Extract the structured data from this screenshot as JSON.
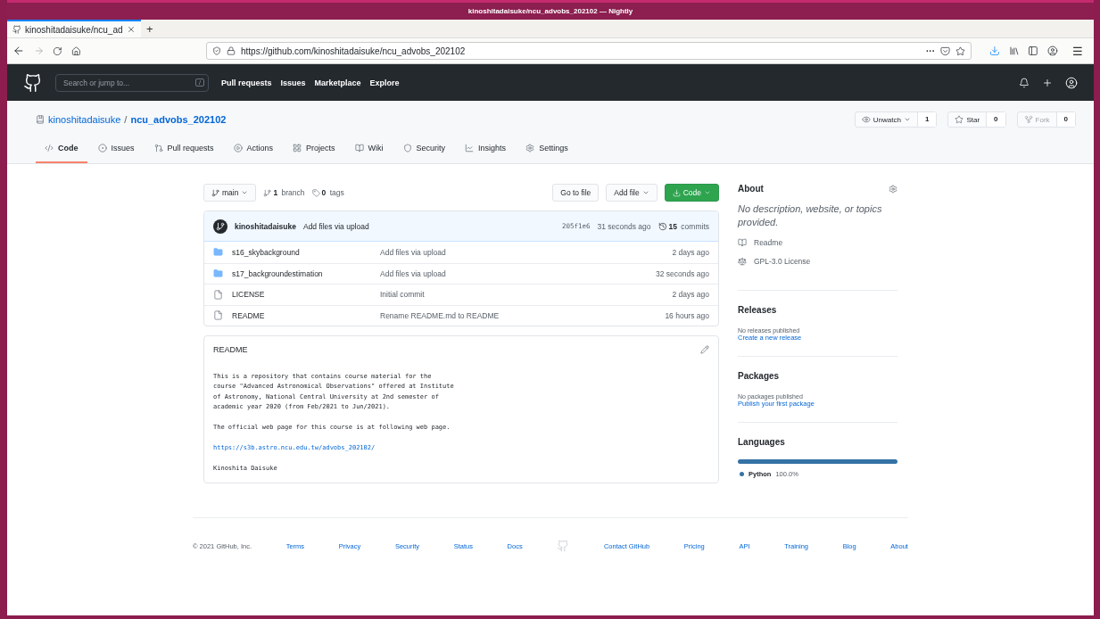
{
  "window": {
    "title": "kinoshitadaisuke/ncu_advobs_202102 — Nightly"
  },
  "browser": {
    "tab": {
      "title": "kinoshitadaisuke/ncu_ad"
    },
    "new_tab": "+",
    "url": "https://github.com/kinoshitadaisuke/ncu_advobs_202102",
    "more": "···",
    "menu": "☰"
  },
  "header": {
    "search_placeholder": "Search or jump to...",
    "slash_key": "/",
    "nav": [
      "Pull requests",
      "Issues",
      "Marketplace",
      "Explore"
    ]
  },
  "repo": {
    "owner": "kinoshitadaisuke",
    "separator": "/",
    "name": "ncu_advobs_202102",
    "actions": [
      {
        "label": "Unwatch",
        "count": "1",
        "disabled": false
      },
      {
        "label": "Star",
        "count": "0",
        "disabled": false
      },
      {
        "label": "Fork",
        "count": "0",
        "disabled": true
      }
    ]
  },
  "tabs": [
    {
      "label": "Code",
      "selected": true
    },
    {
      "label": "Issues",
      "selected": false
    },
    {
      "label": "Pull requests",
      "selected": false
    },
    {
      "label": "Actions",
      "selected": false
    },
    {
      "label": "Projects",
      "selected": false
    },
    {
      "label": "Wiki",
      "selected": false
    },
    {
      "label": "Security",
      "selected": false
    },
    {
      "label": "Insights",
      "selected": false
    },
    {
      "label": "Settings",
      "selected": false
    }
  ],
  "toolbar": {
    "branch": "main",
    "branch_count": "1",
    "branch_label": "branch",
    "tag_count": "0",
    "tag_label": "tags",
    "buttons": [
      {
        "label": "Go to file",
        "kind": "plain"
      },
      {
        "label": "Add file",
        "kind": "menu"
      },
      {
        "label": "Code",
        "kind": "primary"
      }
    ]
  },
  "commit": {
    "author": "kinoshitadaisuke",
    "message": "Add files via upload",
    "hash": "205f1e6",
    "time": "31 seconds ago",
    "count": "15",
    "count_label": "commits"
  },
  "files": [
    {
      "kind": "folder",
      "name": "s16_skybackground",
      "message": "Add files via upload",
      "time": "2 days ago"
    },
    {
      "kind": "folder",
      "name": "s17_backgroundestimation",
      "message": "Add files via upload",
      "time": "32 seconds ago"
    },
    {
      "kind": "file",
      "name": "LICENSE",
      "message": "Initial commit",
      "time": "2 days ago"
    },
    {
      "kind": "file",
      "name": "README",
      "message": "Rename README.md to README",
      "time": "16 hours ago"
    }
  ],
  "readme": {
    "title": "README",
    "blocks": [
      {
        "kind": "text",
        "lines": [
          "This is a repository that contains course material for the",
          "course \"Advanced Astronomical Observations\" offered at Institute",
          "of Astronomy, National Central University at 2nd semester of",
          "academic year 2020 (from Feb/2021 to Jun/2021)."
        ]
      },
      {
        "kind": "text",
        "lines": [
          "The official web page for this course is at following web page."
        ]
      },
      {
        "kind": "link",
        "lines": [
          "https://s3b.astro.ncu.edu.tw/advobs_202102/"
        ]
      },
      {
        "kind": "text",
        "lines": [
          "Kinoshita Daisuke"
        ]
      }
    ]
  },
  "sidebar": {
    "about": {
      "title": "About",
      "description": "No description, website, or topics provided.",
      "links": [
        "Readme",
        "GPL-3.0 License"
      ]
    },
    "releases": {
      "title": "Releases",
      "note": "No releases published",
      "link": "Create a new release"
    },
    "packages": {
      "title": "Packages",
      "note": "No packages published",
      "link": "Publish your first package"
    },
    "languages": {
      "title": "Languages",
      "items": [
        {
          "name": "Python",
          "percent": "100.0%",
          "level": 1,
          "color": "#3572a5"
        }
      ]
    }
  },
  "footer": {
    "copyright": "© 2021 GitHub, Inc.",
    "left_links": [
      "Terms",
      "Privacy",
      "Security",
      "Status",
      "Docs"
    ],
    "right_links": [
      "Contact GitHub",
      "Pricing",
      "API",
      "Training",
      "Blog",
      "About"
    ]
  }
}
